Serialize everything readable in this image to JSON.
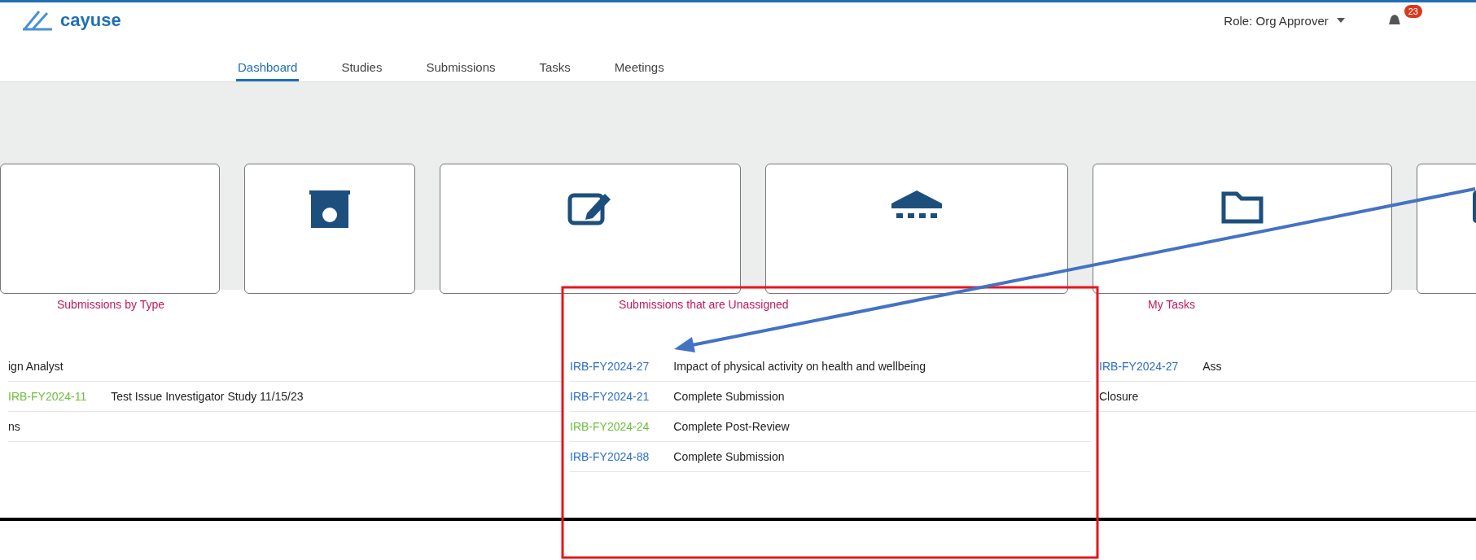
{
  "header": {
    "logo": "cayuse",
    "role": "Role: Org Approver",
    "notification_count": "23"
  },
  "nav": [
    {
      "label": "Dashboard",
      "selected": true
    },
    {
      "label": "Studies",
      "selected": false
    },
    {
      "label": "Submissions",
      "selected": false
    },
    {
      "label": "Tasks",
      "selected": false
    },
    {
      "label": "Meetings",
      "selected": false
    }
  ],
  "cards": [
    {
      "kind": "blank"
    },
    {
      "kind": "badge"
    },
    {
      "kind": "edit"
    },
    {
      "kind": "bank"
    },
    {
      "kind": "folder"
    },
    {
      "kind": "card"
    }
  ],
  "panels": [
    {
      "title": "Submissions by Type",
      "rows": [
        {
          "text": "ign Analyst"
        },
        {
          "id": "IRB-FY2024-11",
          "color": "#6cbf3a",
          "text": "Test Issue Investigator Study 11/15/23"
        },
        {
          "text": "ns"
        }
      ]
    },
    {
      "title": "Submissions that are Unassigned",
      "rows": [
        {
          "id": "IRB-FY2024-27",
          "color": "#2a6fc9",
          "text": "Impact of physical activity on health and wellbeing"
        },
        {
          "id": "IRB-FY2024-21",
          "color": "#2a6fc9",
          "text": "Complete Submission"
        },
        {
          "id": "IRB-FY2024-24",
          "color": "#6cbf3a",
          "text": "Complete Post-Review"
        },
        {
          "id": "IRB-FY2024-88",
          "color": "#2a6fc9",
          "text": "Complete Submission"
        }
      ]
    },
    {
      "title": "My Tasks",
      "rows": [
        {
          "id": "IRB-FY2024-27",
          "color": "#2a6fc9",
          "text": "Ass"
        },
        {
          "text": "Closure"
        }
      ]
    }
  ]
}
